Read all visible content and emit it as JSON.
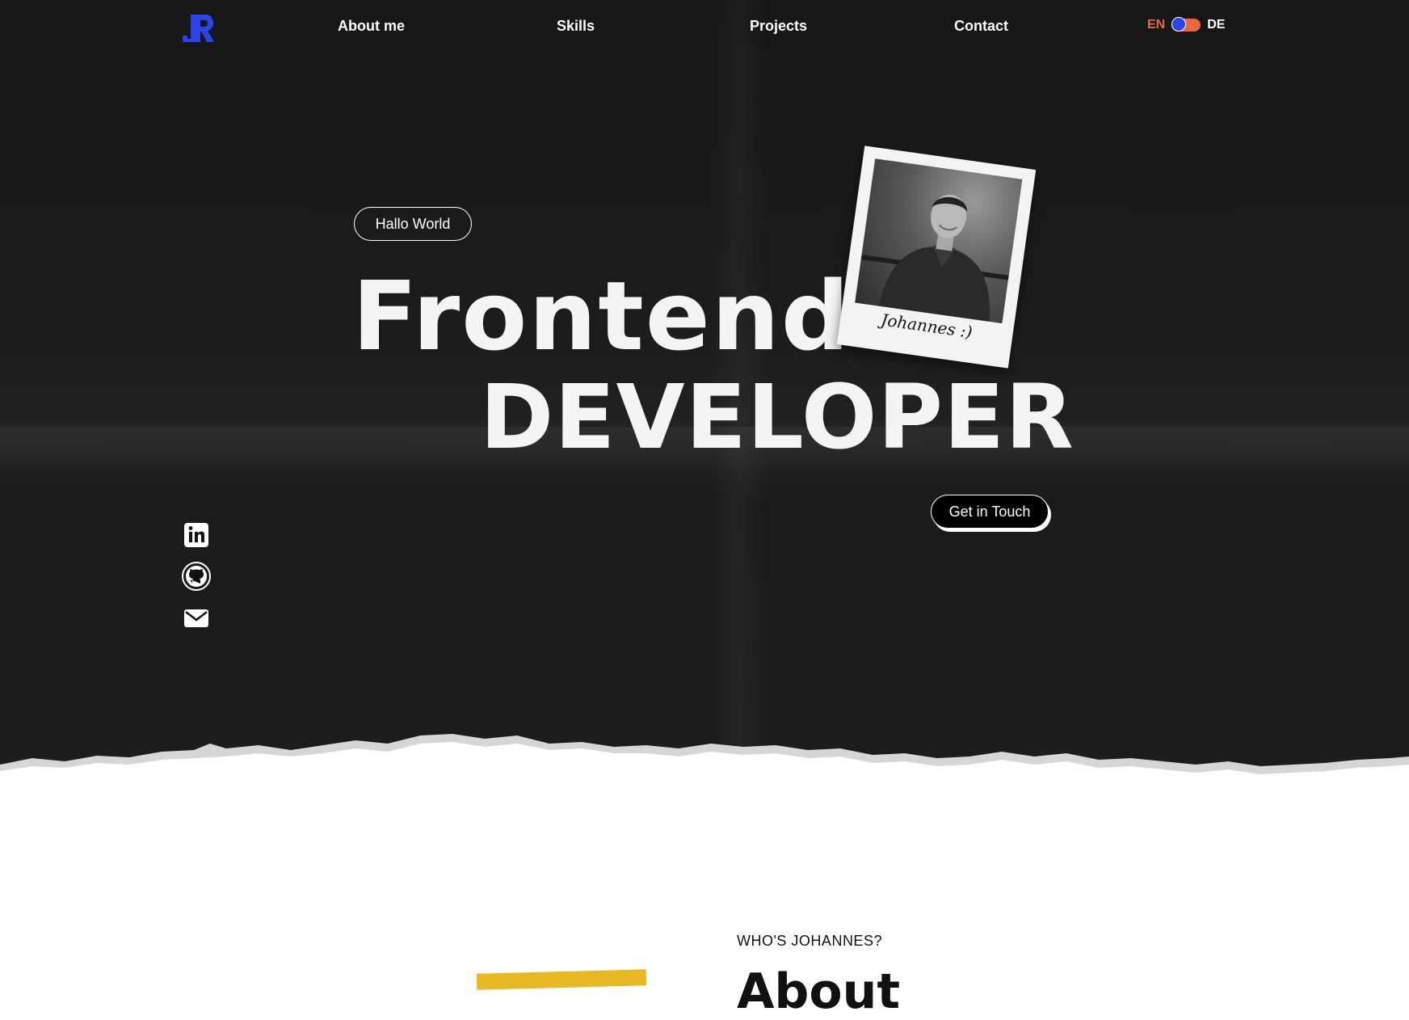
{
  "brand": {
    "logo_text": "JR",
    "logo_color": "#2c43e8"
  },
  "nav": {
    "items": [
      {
        "label": "About me"
      },
      {
        "label": "Skills"
      },
      {
        "label": "Projects"
      },
      {
        "label": "Contact"
      }
    ]
  },
  "language": {
    "left": "EN",
    "right": "DE",
    "active": "EN",
    "accent": "#e8673f",
    "knob_color": "#2c43e8"
  },
  "hero": {
    "greeting": "Hallo World",
    "title_line1": "Frontend",
    "title_line2": "DEVELOPER",
    "polaroid_caption": "Johannes :)",
    "cta_label": "Get in Touch"
  },
  "social": {
    "icons": [
      "linkedin-icon",
      "github-icon",
      "mail-icon"
    ]
  },
  "about": {
    "eyebrow": "WHO'S JOHANNES?",
    "heading": "About"
  }
}
